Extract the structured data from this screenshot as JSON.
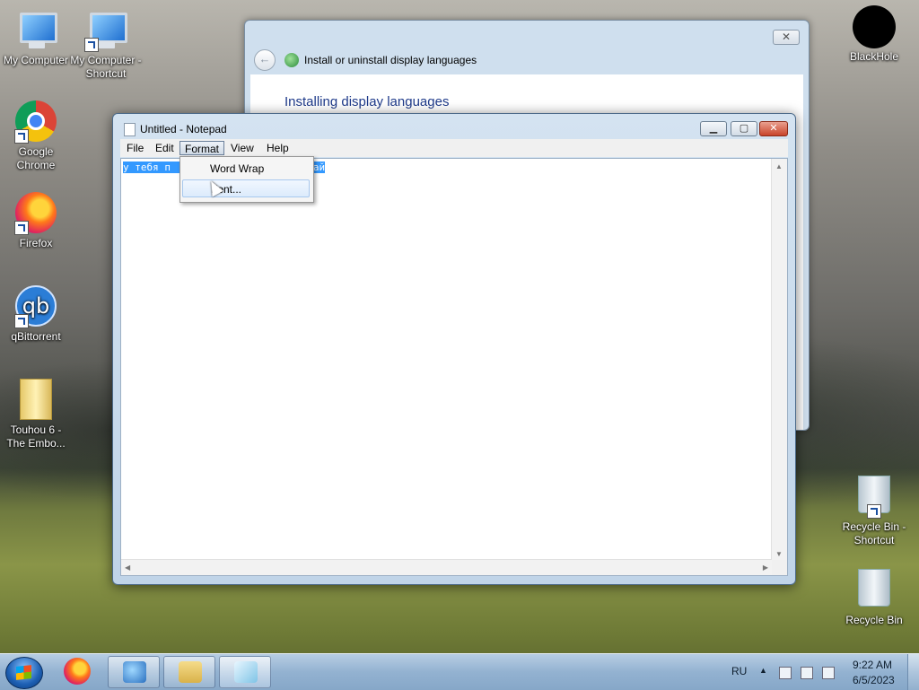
{
  "desktop": {
    "icons": [
      {
        "label": "My Computer",
        "icon": "computer-icon"
      },
      {
        "label": "My Computer - Shortcut",
        "icon": "computer-shortcut-icon"
      },
      {
        "label": "Google Chrome",
        "icon": "chrome-icon"
      },
      {
        "label": "Firefox",
        "icon": "firefox-icon"
      },
      {
        "label": "qBittorrent",
        "icon": "qbittorrent-icon",
        "glyph": "qb"
      },
      {
        "label": "Touhou 6  - The Embo...",
        "icon": "folder-icon"
      },
      {
        "label": "BlackHole",
        "icon": "blackhole-icon"
      },
      {
        "label": "Recycle Bin - Shortcut",
        "icon": "recycle-bin-shortcut-icon"
      },
      {
        "label": "Recycle Bin",
        "icon": "recycle-bin-icon"
      }
    ]
  },
  "background_window": {
    "title": "Install or uninstall display languages",
    "heading": "Installing display languages",
    "close_glyph": "✕",
    "back_glyph": "←"
  },
  "notepad": {
    "title": "Untitled - Notepad",
    "caption_buttons": {
      "minimize": "▁",
      "maximize": "▢",
      "close": "✕"
    },
    "menu": [
      "File",
      "Edit",
      "Format",
      "View",
      "Help"
    ],
    "open_menu": "Format",
    "selected_text": "у тебя п              е или вайфай",
    "scroll_arrows": {
      "up": "▲",
      "down": "▼",
      "left": "◀",
      "right": "▶"
    }
  },
  "format_menu": {
    "items": [
      "Word Wrap",
      "Font..."
    ],
    "hovered": "Font..."
  },
  "taskbar": {
    "language": "RU",
    "time": "9:22 AM",
    "date": "6/5/2023",
    "tray_up_glyph": "▲"
  },
  "colors": {
    "selection": "#3399ff",
    "title_close": "#c9442a",
    "heading_blue": "#1e3a8a"
  }
}
